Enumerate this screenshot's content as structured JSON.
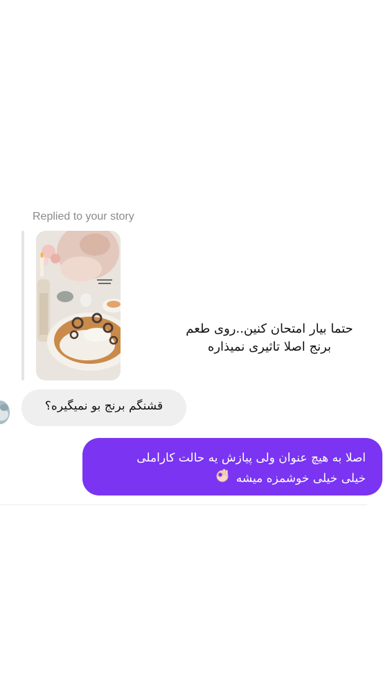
{
  "story_reply": {
    "label": "Replied to your story",
    "overlay_text_line1": "حتما بیار امتحان کنین..روی طعم",
    "overlay_text_line2": "برنج اصلا تاثیری نمیذاره"
  },
  "messages": [
    {
      "direction": "incoming",
      "text": "قشنگم برنج بو نمیگیره؟"
    },
    {
      "direction": "outgoing",
      "line1": "اصلا به هیچ عنوان ولی پیازش یه حالت کاراملی",
      "line2": "خیلی خیلی  خوشمزه میشه",
      "emoji": "ok-hand-emoji"
    }
  ],
  "colors": {
    "outgoing_bubble": "#7a34f2",
    "incoming_bubble": "#efefef",
    "label_gray": "#8a8a8a"
  }
}
